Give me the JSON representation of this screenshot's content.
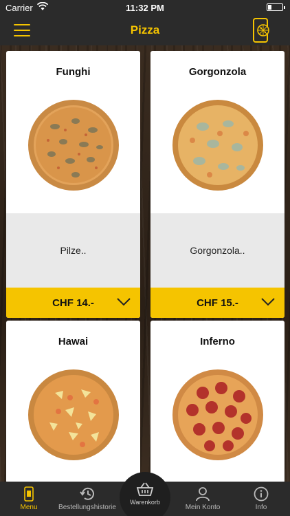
{
  "status_bar": {
    "carrier": "Carrier",
    "time": "11:32 PM"
  },
  "nav": {
    "title": "Pizza",
    "menu_icon": "hamburger-menu-icon",
    "right_icon": "phone-pizza-icon"
  },
  "pizzas": [
    {
      "name": "Funghi",
      "description": "Pilze..",
      "price": "CHF 14.-",
      "topping": "mushroom"
    },
    {
      "name": "Gorgonzola",
      "description": "Gorgonzola..",
      "price": "CHF 15.-",
      "topping": "cheese"
    },
    {
      "name": "Hawai",
      "description": "",
      "price": "",
      "topping": "pineapple"
    },
    {
      "name": "Inferno",
      "description": "",
      "price": "",
      "topping": "pepperoni"
    }
  ],
  "tabs": [
    {
      "label": "Menu",
      "icon": "phone-menu-icon",
      "active": true
    },
    {
      "label": "Bestellungshistorie",
      "icon": "history-icon",
      "active": false
    },
    {
      "label": "Warenkorb",
      "icon": "basket-icon",
      "active": false
    },
    {
      "label": "Mein Konto",
      "icon": "user-icon",
      "active": false
    },
    {
      "label": "Info",
      "icon": "info-icon",
      "active": false
    }
  ],
  "colors": {
    "accent": "#f5c400",
    "bar": "#2b2b2b",
    "card_desc_bg": "#e9e9e9"
  }
}
